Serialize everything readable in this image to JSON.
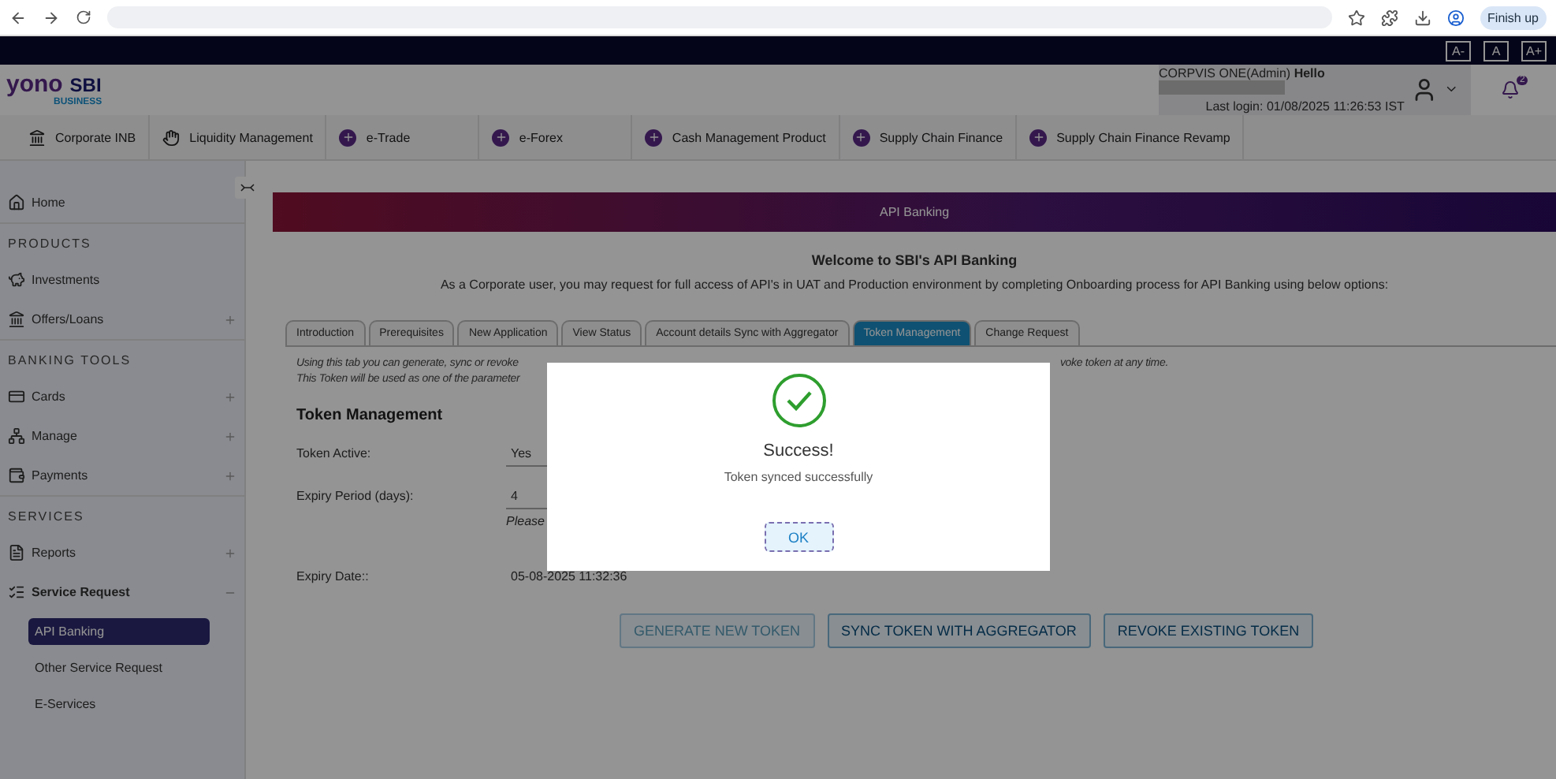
{
  "browser": {
    "finish_button": "Finish up"
  },
  "font_controls": [
    "A-",
    "A",
    "A+"
  ],
  "header": {
    "user": "CORPVIS ONE(Admin)",
    "greeting": "Hello",
    "last_login": "Last login: 01/08/2025 11:26:53 IST",
    "notification_count": "2",
    "logo": {
      "yono": "yono",
      "sbi": "SBI",
      "business": "BUSINESS"
    }
  },
  "menu": [
    {
      "label": "Corporate INB",
      "kind": "bank"
    },
    {
      "label": "Liquidity Management",
      "kind": "hand"
    },
    {
      "label": "e-Trade",
      "kind": "plus"
    },
    {
      "label": "e-Forex",
      "kind": "plus"
    },
    {
      "label": "Cash Management Product",
      "kind": "plus"
    },
    {
      "label": "Supply Chain Finance",
      "kind": "plus"
    },
    {
      "label": "Supply Chain Finance Revamp",
      "kind": "plus"
    }
  ],
  "sidebar": {
    "items": [
      {
        "kind": "item",
        "label": "Home"
      },
      {
        "kind": "section",
        "label": "PRODUCTS"
      },
      {
        "kind": "item",
        "label": "Investments"
      },
      {
        "kind": "item",
        "label": "Offers/Loans",
        "expandable": true
      },
      {
        "kind": "section",
        "label": "BANKING TOOLS"
      },
      {
        "kind": "item",
        "label": "Cards",
        "expandable": true
      },
      {
        "kind": "item",
        "label": "Manage",
        "expandable": true
      },
      {
        "kind": "item",
        "label": "Payments",
        "expandable": true
      },
      {
        "kind": "section",
        "label": "SERVICES"
      },
      {
        "kind": "item",
        "label": "Reports",
        "expandable": true
      },
      {
        "kind": "item",
        "label": "Service Request",
        "expandable": true,
        "expanded": true,
        "children": [
          {
            "label": "API Banking",
            "selected": true
          },
          {
            "label": "Other Service Request",
            "selected": false
          },
          {
            "label": "E-Services",
            "selected": false
          }
        ]
      }
    ]
  },
  "banner": "API Banking",
  "welcome": {
    "title": "Welcome to SBI's API Banking",
    "text": "As a Corporate user, you may request for full access of API's in UAT and Production environment by completing Onboarding process for API Banking using below options:"
  },
  "tabs": [
    {
      "label": "Introduction",
      "selected": false
    },
    {
      "label": "Prerequisites",
      "selected": false
    },
    {
      "label": "New Application",
      "selected": false
    },
    {
      "label": "View Status",
      "selected": false
    },
    {
      "label": "Account details Sync with Aggregator",
      "selected": false
    },
    {
      "label": "Token Management",
      "selected": true
    },
    {
      "label": "Change Request",
      "selected": false
    }
  ],
  "intro_lines": [
    {
      "left": "Using this tab you can generate, sync or revoke",
      "right": "voke token at any time."
    },
    {
      "left": "This Token will be used as one of the parameter"
    }
  ],
  "section_title": "Token Management",
  "fields": [
    {
      "label": "Token Active:",
      "value": "Yes",
      "underline": true
    },
    {
      "label": "Expiry Period (days):",
      "value": "4",
      "underline": true,
      "hint": "Please"
    },
    {
      "label": "Expiry Date::",
      "value": "05-08-2025 11:32:36",
      "underline": false
    }
  ],
  "buttons": [
    {
      "label": "GENERATE NEW TOKEN",
      "disabled": true
    },
    {
      "label": "SYNC TOKEN WITH AGGREGATOR",
      "disabled": false
    },
    {
      "label": "REVOKE EXISTING TOKEN",
      "disabled": false
    }
  ],
  "dialog": {
    "title": "Success!",
    "message": "Token synced successfully",
    "ok": "OK"
  }
}
